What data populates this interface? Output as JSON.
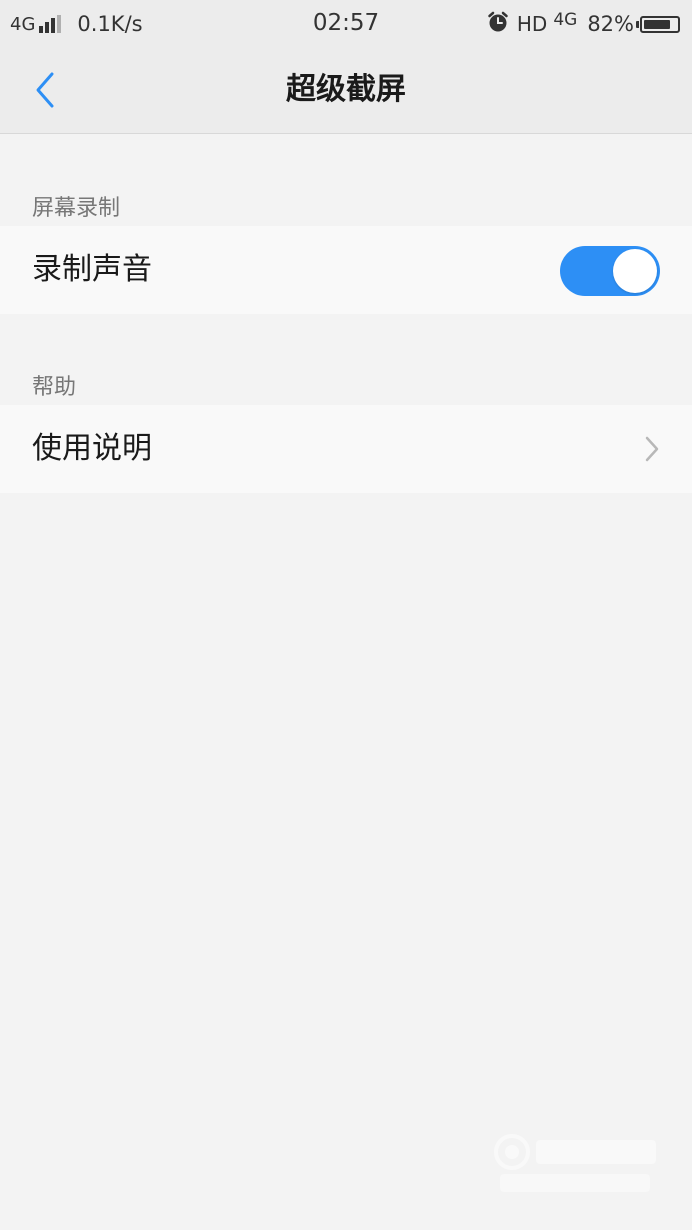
{
  "status_bar": {
    "network": "4G",
    "speed": "0.1K/s",
    "time": "02:57",
    "hd": "HD",
    "network2": "4G",
    "battery_percent": "82%",
    "battery_level": 0.82
  },
  "header": {
    "title": "超级截屏",
    "back_icon": "chevron-left-icon"
  },
  "sections": {
    "recording": {
      "header": "屏幕录制",
      "row_label": "录制声音",
      "toggle_on": true
    },
    "help": {
      "header": "帮助",
      "row_label": "使用说明",
      "row_icon": "chevron-right-icon"
    }
  },
  "colors": {
    "accent": "#2d8ff5",
    "background": "#f3f3f3",
    "row_background": "#f9f9f9"
  }
}
